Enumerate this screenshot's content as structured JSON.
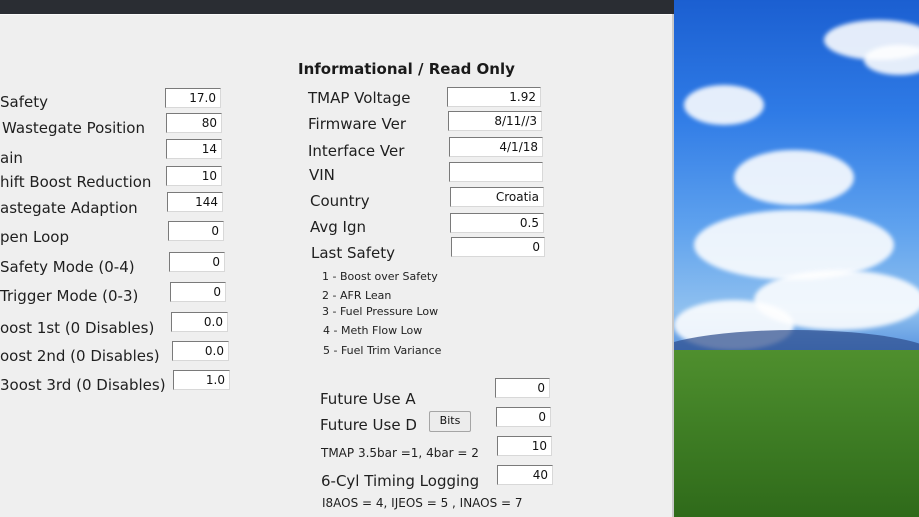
{
  "panel_title": "Informational / Read Only",
  "left_settings": [
    {
      "label": "Safety",
      "value": "17.0"
    },
    {
      "label": "Wastegate Position",
      "value": "80"
    },
    {
      "label": "ain",
      "value": "14"
    },
    {
      "label": "hift Boost Reduction",
      "value": "10"
    },
    {
      "label": "astegate Adaption",
      "value": "144"
    },
    {
      "label": "pen Loop",
      "value": "0"
    },
    {
      "label": "Safety Mode (0-4)",
      "value": "0"
    },
    {
      "label": "Trigger Mode (0-3)",
      "value": "0"
    },
    {
      "label": "oost 1st (0 Disables)",
      "value": "0.0"
    },
    {
      "label": "oost 2nd (0 Disables)",
      "value": "0.0"
    },
    {
      "label": "3oost 3rd (0 Disables)",
      "value": "1.0"
    }
  ],
  "info_fields": [
    {
      "label": "TMAP Voltage",
      "value": "1.92"
    },
    {
      "label": "Firmware Ver",
      "value": "8/11//3"
    },
    {
      "label": "Interface Ver",
      "value": "4/1/18"
    },
    {
      "label": "VIN",
      "value": ""
    },
    {
      "label": "Country",
      "value": "Croatia"
    },
    {
      "label": "Avg Ign",
      "value": "0.5"
    },
    {
      "label": "Last Safety",
      "value": "0"
    }
  ],
  "safety_codes": [
    "1 - Boost over Safety",
    "2 - AFR Lean",
    "3 - Fuel Pressure Low",
    "4 - Meth Flow Low",
    "5 - Fuel Trim Variance"
  ],
  "future": {
    "use_a_label": "Future Use A",
    "use_a_value": "0",
    "use_d_label": "Future Use D",
    "bits_button": "Bits",
    "use_d_value": "0",
    "tmap_label": "TMAP 3.5bar =1, 4bar = 2",
    "tmap_value": "10",
    "timing_label": "6-Cyl Timing Logging",
    "timing_value": "40",
    "footer_note": "I8AOS = 4, IJEOS = 5 , INAOS = 7"
  },
  "colors": {
    "panel_bg": "#efefef",
    "desktop_sky": "#2f7be6",
    "field_bg": "#ffffff"
  }
}
